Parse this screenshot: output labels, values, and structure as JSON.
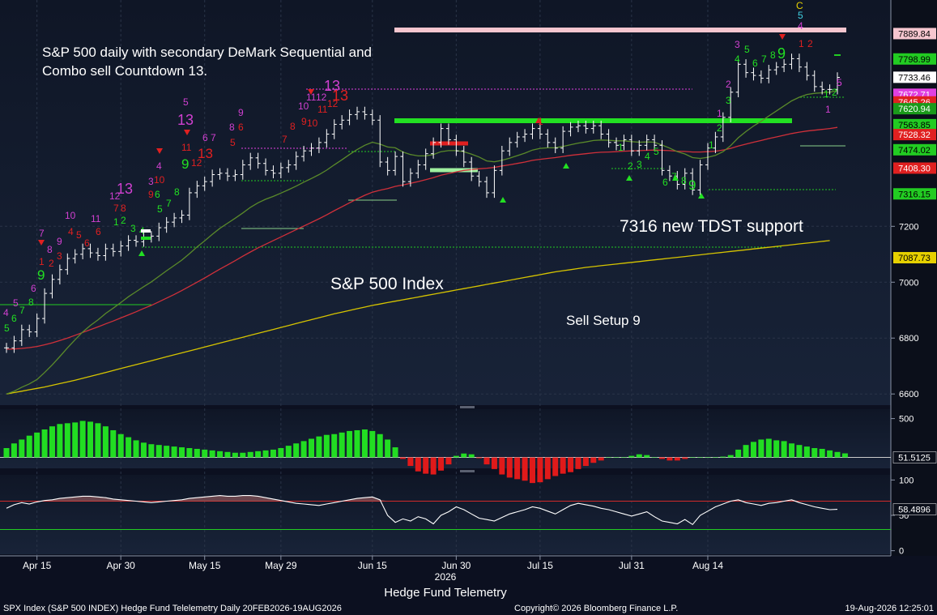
{
  "footer": {
    "ticker_line": "SPX Index (S&P 500 INDEX) Hedge Fund Telelemetry Daily 20FEB2026-19AUG2026",
    "copyright": "Copyright© 2026 Bloomberg Finance L.P.",
    "timestamp": "19-Aug-2026 12:25:01"
  },
  "chart_data": [
    {
      "type": "line",
      "panel": "price",
      "title": "",
      "annotations": [
        "S&P 500 daily with secondary DeMark Sequential and",
        "Combo sell Countdown 13.",
        "7316 new TDST support",
        "S&P 500 Index",
        "Sell Setup 9"
      ],
      "xlabel": "Hedge Fund Telemetry",
      "x_year": "2026",
      "x_ticks": [
        "Apr 15",
        "Apr 30",
        "May 15",
        "May 29",
        "Jun 15",
        "Jun 30",
        "Jul 15",
        "Jul 31",
        "Aug 14"
      ],
      "ylim": [
        6560,
        8010
      ],
      "y_ticks": [
        6600,
        6800,
        7000,
        7200
      ],
      "price_tags": [
        {
          "label": "7889.84",
          "value": 7889.84,
          "color": "#f6c6cf"
        },
        {
          "label": "7798.99",
          "value": 7798.99,
          "color": "#22cc22"
        },
        {
          "label": "7733.46",
          "value": 7733.46,
          "color": "#ffffff"
        },
        {
          "label": "7672.71",
          "value": 7672.71,
          "color": "#e040e0"
        },
        {
          "label": "7645.26",
          "value": 7645.26,
          "color": "#e02020"
        },
        {
          "label": "7620.94",
          "value": 7620.94,
          "color": "#1a9a1a"
        },
        {
          "label": "7563.85",
          "value": 7563.85,
          "color": "#22cc22"
        },
        {
          "label": "7528.32",
          "value": 7528.32,
          "color": "#e02020"
        },
        {
          "label": "7474.02",
          "value": 7474.02,
          "color": "#22cc22"
        },
        {
          "label": "7408.30",
          "value": 7408.3,
          "color": "#e02020"
        },
        {
          "label": "7316.15",
          "value": 7316.15,
          "color": "#22cc22"
        },
        {
          "label": "7087.73",
          "value": 7087.73,
          "color": "#e6d000"
        }
      ],
      "close": [
        6765,
        6790,
        6830,
        6822,
        6870,
        6960,
        7010,
        7045,
        7085,
        7100,
        7120,
        7105,
        7095,
        7120,
        7110,
        7130,
        7150,
        7145,
        7160,
        7165,
        7195,
        7215,
        7230,
        7240,
        7320,
        7345,
        7360,
        7385,
        7390,
        7380,
        7385,
        7420,
        7445,
        7425,
        7400,
        7390,
        7410,
        7420,
        7450,
        7470,
        7480,
        7500,
        7530,
        7565,
        7580,
        7600,
        7610,
        7600,
        7580,
        7430,
        7400,
        7450,
        7360,
        7390,
        7420,
        7460,
        7500,
        7550,
        7510,
        7470,
        7430,
        7380,
        7360,
        7320,
        7400,
        7470,
        7500,
        7520,
        7530,
        7550,
        7530,
        7500,
        7480,
        7540,
        7555,
        7560,
        7550,
        7560,
        7530,
        7500,
        7490,
        7510,
        7470,
        7490,
        7510,
        7490,
        7400,
        7380,
        7350,
        7390,
        7330,
        7420,
        7480,
        7520,
        7590,
        7680,
        7780,
        7750,
        7740,
        7730,
        7760,
        7770,
        7780,
        7800,
        7770,
        7740,
        7700,
        7690,
        7690,
        7733
      ],
      "ema_green": [
        6600,
        6610,
        6624,
        6636,
        6652,
        6677,
        6704,
        6734,
        6765,
        6794,
        6822,
        6845,
        6865,
        6888,
        6907,
        6927,
        6948,
        6966,
        6984,
        7001,
        7021,
        7041,
        7060,
        7079,
        7102,
        7126,
        7148,
        7171,
        7193,
        7211,
        7229,
        7248,
        7268,
        7284,
        7297,
        7307,
        7319,
        7331,
        7344,
        7358,
        7371,
        7385,
        7401,
        7420,
        7438,
        7457,
        7475,
        7490,
        7501,
        7494,
        7484,
        7481,
        7466,
        7457,
        7452,
        7452,
        7457,
        7467,
        7471,
        7471,
        7467,
        7458,
        7448,
        7434,
        7431,
        7436,
        7444,
        7453,
        7462,
        7473,
        7479,
        7481,
        7481,
        7486,
        7492,
        7498,
        7502,
        7507,
        7509,
        7508,
        7506,
        7506,
        7503,
        7501,
        7502,
        7501,
        7491,
        7480,
        7467,
        7459,
        7446,
        7443,
        7447,
        7454,
        7467,
        7489,
        7517,
        7539,
        7559,
        7576,
        7595,
        7613,
        7631,
        7649,
        7662,
        7672,
        7676,
        7678,
        7680,
        7686
      ],
      "sma50_red": [
        6760,
        6761,
        6763,
        6766,
        6770,
        6776,
        6783,
        6791,
        6800,
        6810,
        6820,
        6830,
        6840,
        6851,
        6861,
        6872,
        6883,
        6894,
        6906,
        6917,
        6930,
        6943,
        6956,
        6970,
        6985,
        7000,
        7015,
        7031,
        7047,
        7062,
        7077,
        7093,
        7108,
        7123,
        7136,
        7149,
        7162,
        7175,
        7188,
        7201,
        7214,
        7227,
        7241,
        7256,
        7270,
        7284,
        7298,
        7311,
        7322,
        7329,
        7335,
        7343,
        7348,
        7354,
        7360,
        7367,
        7374,
        7383,
        7389,
        7395,
        7400,
        7403,
        7406,
        7408,
        7411,
        7416,
        7420,
        7425,
        7430,
        7436,
        7440,
        7443,
        7446,
        7450,
        7454,
        7457,
        7460,
        7463,
        7465,
        7466,
        7467,
        7469,
        7470,
        7471,
        7472,
        7473,
        7472,
        7471,
        7469,
        7468,
        7466,
        7466,
        7467,
        7469,
        7473,
        7479,
        7487,
        7494,
        7501,
        7507,
        7514,
        7520,
        7526,
        7532,
        7537,
        7541,
        7544,
        7547,
        7550,
        7554
      ],
      "sma200_yellow": [
        6600,
        6605,
        6610,
        6615,
        6620,
        6625,
        6631,
        6637,
        6643,
        6649,
        6656,
        6663,
        6670,
        6677,
        6684,
        6691,
        6698,
        6705,
        6712,
        6719,
        6726,
        6733,
        6740,
        6747,
        6754,
        6761,
        6768,
        6775,
        6782,
        6789,
        6796,
        6803,
        6810,
        6817,
        6824,
        6831,
        6838,
        6845,
        6852,
        6859,
        6866,
        6873,
        6880,
        6887,
        6893,
        6899,
        6905,
        6911,
        6917,
        6922,
        6927,
        6932,
        6937,
        6942,
        6947,
        6952,
        6957,
        6962,
        6967,
        6972,
        6977,
        6982,
        6987,
        6992,
        6997,
        7002,
        7007,
        7012,
        7017,
        7022,
        7027,
        7032,
        7037,
        7041,
        7045,
        7049,
        7053,
        7056,
        7059,
        7062,
        7065,
        7068,
        7071,
        7074,
        7077,
        7080,
        7083,
        7086,
        7089,
        7092,
        7095,
        7098,
        7101,
        7104,
        7107,
        7110,
        7113,
        7116,
        7119,
        7122,
        7125,
        7128,
        7131,
        7134,
        7137,
        7140,
        7143,
        7146,
        7149,
        7087.73
      ]
    },
    {
      "type": "bar",
      "panel": "momentum",
      "ylim": [
        -120,
        600
      ],
      "y_ticks": [
        500
      ],
      "last_value_label": "51.5125",
      "values": [
        120,
        180,
        230,
        280,
        320,
        360,
        400,
        430,
        440,
        450,
        470,
        460,
        440,
        400,
        350,
        300,
        260,
        220,
        190,
        170,
        160,
        150,
        140,
        130,
        120,
        110,
        100,
        90,
        80,
        70,
        60,
        60,
        70,
        80,
        90,
        100,
        120,
        150,
        180,
        210,
        240,
        270,
        290,
        300,
        320,
        340,
        350,
        360,
        340,
        300,
        230,
        130,
        -20,
        -110,
        -180,
        -210,
        -220,
        -170,
        -90,
        20,
        50,
        40,
        -10,
        -90,
        -150,
        -220,
        -260,
        -280,
        -300,
        -330,
        -320,
        -280,
        -240,
        -210,
        -190,
        -150,
        -110,
        -70,
        -40,
        0,
        0,
        0,
        20,
        40,
        30,
        0,
        -20,
        -40,
        -40,
        -20,
        0,
        0,
        0,
        0,
        10,
        30,
        100,
        160,
        200,
        230,
        240,
        220,
        210,
        180,
        160,
        140,
        120,
        110,
        90,
        70,
        52
      ]
    },
    {
      "type": "line",
      "panel": "oscillator",
      "ylim": [
        -5,
        105
      ],
      "y_ticks": [
        100,
        50,
        0
      ],
      "bands": [
        70,
        30
      ],
      "last_value_label": "58.4896",
      "values": [
        60,
        65,
        68,
        66,
        69,
        71,
        72,
        74,
        75,
        76,
        77,
        77,
        76,
        75,
        73,
        72,
        71,
        70,
        69,
        68,
        69,
        70,
        71,
        72,
        74,
        75,
        76,
        77,
        78,
        77,
        77,
        78,
        78,
        77,
        75,
        73,
        71,
        69,
        67,
        66,
        65,
        64,
        66,
        68,
        70,
        72,
        74,
        75,
        76,
        72,
        50,
        40,
        45,
        42,
        48,
        45,
        38,
        50,
        55,
        62,
        58,
        52,
        46,
        44,
        42,
        47,
        52,
        55,
        58,
        62,
        60,
        56,
        52,
        58,
        64,
        67,
        65,
        63,
        60,
        58,
        55,
        52,
        49,
        52,
        55,
        48,
        42,
        40,
        38,
        44,
        37,
        50,
        56,
        62,
        66,
        70,
        72,
        68,
        66,
        64,
        67,
        68,
        70,
        72,
        68,
        65,
        62,
        60,
        58,
        58.49
      ]
    }
  ]
}
